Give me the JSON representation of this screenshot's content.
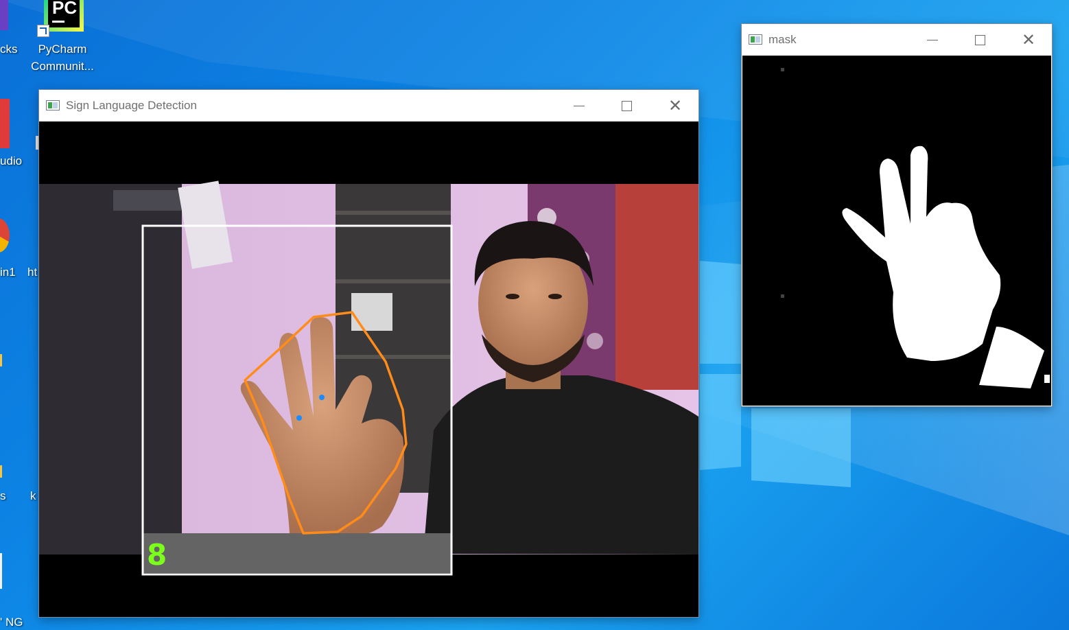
{
  "desktop": {
    "icons": [
      {
        "label": "cks"
      },
      {
        "label": "PyCharm Communit..."
      },
      {
        "label": "udio"
      },
      {
        "label": "in1"
      },
      {
        "label": "ht"
      },
      {
        "label": "s"
      },
      {
        "label": "k"
      },
      {
        "label": "' NG"
      }
    ],
    "pycharm_logo_text": "PC"
  },
  "main_window": {
    "title": "Sign Language Detection",
    "prediction": "8",
    "contour_color": "#ff8c1a",
    "roi_color": "#ffffff",
    "prediction_color": "#7cff1a"
  },
  "mask_window": {
    "title": "mask"
  }
}
